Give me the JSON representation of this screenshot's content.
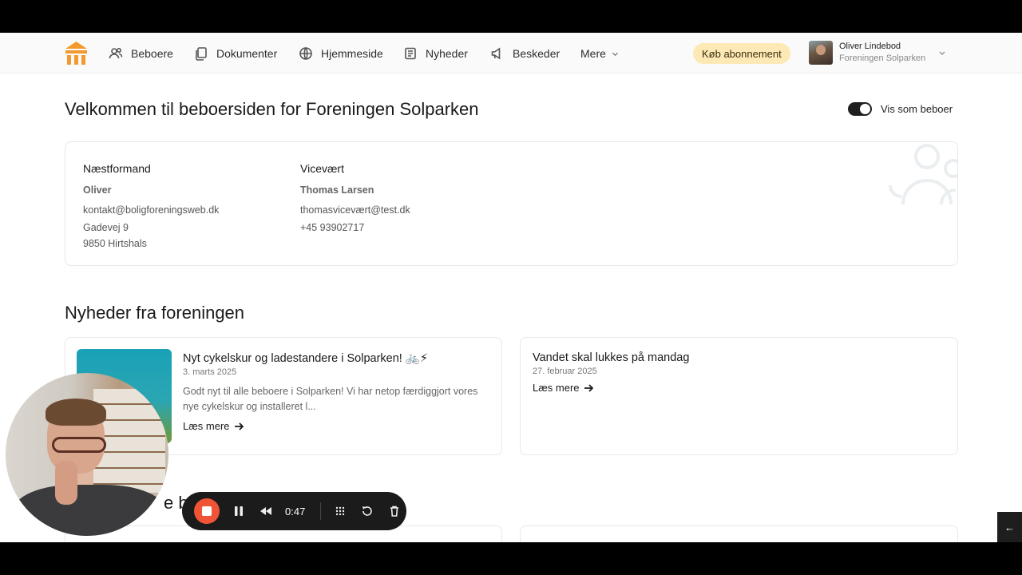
{
  "nav": {
    "items": [
      {
        "label": "Beboere",
        "icon": "users-icon"
      },
      {
        "label": "Dokumenter",
        "icon": "documents-icon"
      },
      {
        "label": "Hjemmeside",
        "icon": "globe-icon"
      },
      {
        "label": "Nyheder",
        "icon": "newspaper-icon"
      },
      {
        "label": "Beskeder",
        "icon": "megaphone-icon"
      },
      {
        "label": "Mere",
        "icon": "chevron-down-icon"
      }
    ],
    "buy_label": "Køb abonnement",
    "user_name": "Oliver Lindebod",
    "user_org": "Foreningen Solparken",
    "colors": {
      "logo": "#f29a2e",
      "buy_bg": "#fde9b6"
    }
  },
  "header": {
    "title": "Velkommen til beboersiden for Foreningen Solparken",
    "toggle_label": "Vis som beboer",
    "toggle_on": true
  },
  "contacts": [
    {
      "role": "Næstformand",
      "name": "Oliver",
      "email": "kontakt@boligforeningsweb.dk",
      "address1": "Gadevej 9",
      "address2": "9850 Hirtshals"
    },
    {
      "role": "Vicevært",
      "name": "Thomas Larsen",
      "email": "thomasvicevært@test.dk",
      "phone": "+45 93902717"
    }
  ],
  "news_section": {
    "title": "Nyheder fra foreningen",
    "items": [
      {
        "title": "Nyt cykelskur og ladestandere i Solparken! 🚲⚡",
        "date": "3. marts 2025",
        "excerpt": "Godt nyt til alle beboere i Solparken! Vi har netop færdiggjort vores nye cykelskur og installeret l...",
        "more": "Læs mere"
      },
      {
        "title": "Vandet skal lukkes på mandag",
        "date": "27. februar 2025",
        "more": "Læs mere"
      }
    ]
  },
  "next_section_title_partial": "e be",
  "recorder": {
    "time": "0:47",
    "record_color": "#ef5436"
  },
  "back_label": "←"
}
